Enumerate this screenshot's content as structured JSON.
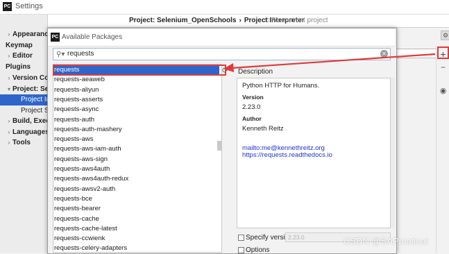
{
  "settings_window": {
    "title": "Settings",
    "logo_text": "PC"
  },
  "sidebar": {
    "items": [
      {
        "label": "Appearance & Behavior",
        "has_arrow": true
      },
      {
        "label": "Keymap",
        "has_arrow": false
      },
      {
        "label": "Editor",
        "has_arrow": true
      },
      {
        "label": "Plugins",
        "has_arrow": false
      },
      {
        "label": "Version Control",
        "has_arrow": true
      },
      {
        "label": "Project: Selenium_OpenSchools",
        "has_arrow": true
      },
      {
        "label": "Project Interpreter",
        "selected": true
      },
      {
        "label": "Project Structure"
      },
      {
        "label": "Build, Execution, Deployment",
        "has_arrow": true
      },
      {
        "label": "Languages & Frameworks",
        "has_arrow": true
      },
      {
        "label": "Tools",
        "has_arrow": true
      }
    ]
  },
  "header": {
    "project": "Project: Selenium_OpenSchools",
    "separator": "›",
    "page": "Project Interpreter",
    "scope": "For current project"
  },
  "right_toolbar": {
    "add": "+",
    "remove": "−",
    "show_icon": "eye-icon"
  },
  "dialog": {
    "title": "Available Packages",
    "logo_text": "PC",
    "search_value": "requests",
    "packages": [
      "requests",
      "requests-aeaweb",
      "requests-aliyun",
      "requests-asserts",
      "requests-async",
      "requests-auth",
      "requests-auth-mashery",
      "requests-aws",
      "requests-aws-iam-auth",
      "requests-aws-sign",
      "requests-aws4auth",
      "requests-aws4auth-redux",
      "requests-awsv2-auth",
      "requests-bce",
      "requests-bearer",
      "requests-cache",
      "requests-cache-latest",
      "requests-ccwienk",
      "requests-celery-adapters"
    ],
    "selected_index": 0,
    "description": {
      "label": "Description",
      "summary": "Python HTTP for Humans.",
      "version_label": "Version",
      "version": "2.23.0",
      "author_label": "Author",
      "author": "Kenneth Reitz",
      "email": "mailto:me@kennethreitz.org",
      "url": "https://requests.readthedocs.io"
    },
    "specify_version_label": "Specify version",
    "specify_version_value": "2.23.0",
    "options_label": "Options"
  },
  "watermark": "CSDN @SAPmatinal",
  "colors": {
    "selection": "#2f65ca",
    "annotation_red": "#e03a3a",
    "link": "#2230d0"
  }
}
